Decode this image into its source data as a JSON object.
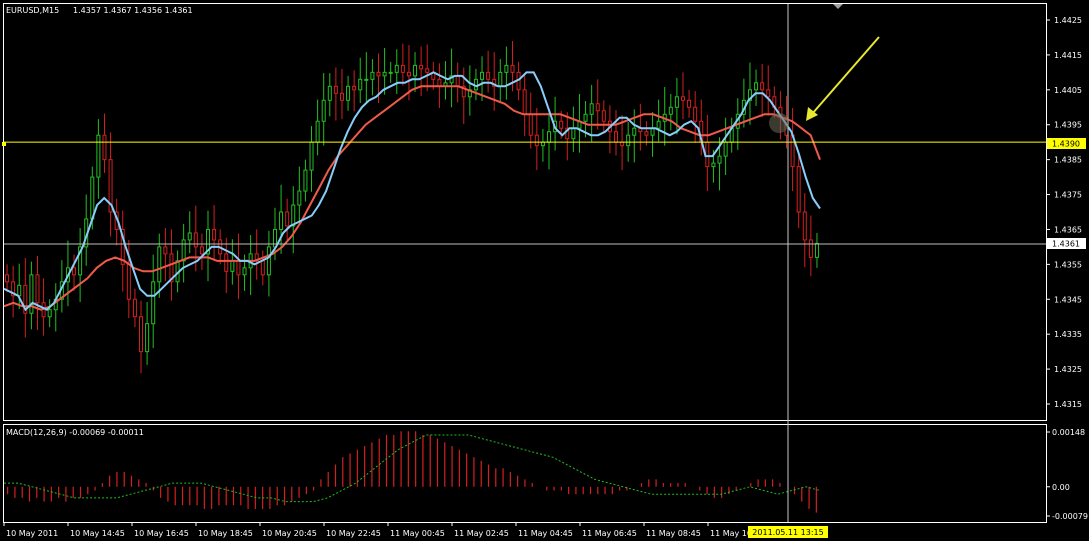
{
  "window": {
    "symbol_label": "EURUSD,M15",
    "ohlc_label": "1.4357 1.4367 1.4356 1.4361"
  },
  "colors": {
    "background": "#000000",
    "axis": "#ffffff",
    "bull": "#22c022",
    "bear": "#d42020",
    "ma_fast": "#87cefa",
    "ma_slow": "#f05a4a",
    "hline": "#ffff00",
    "signal": "#1fbf1f",
    "crosshair": "#c8c8c8",
    "arrow": "#e8e830"
  },
  "price_panel": {
    "ticks": [
      "1.4425",
      "1.4415",
      "1.4405",
      "1.4395",
      "1.4385",
      "1.4375",
      "1.4365",
      "1.4355",
      "1.4345",
      "1.4335",
      "1.4325",
      "1.4315"
    ],
    "hline_value": 1.439,
    "hline_label": "1.4390",
    "current_label": "1.4361",
    "current_value": 1.4361
  },
  "macd_panel": {
    "label": "MACD(12,26,9) -0.00069 -0.00011",
    "ticks": [
      "0.00148",
      "0.00",
      "-0.00079"
    ]
  },
  "time_axis": {
    "labels": [
      "10 May 2011",
      "10 May 14:45",
      "10 May 16:45",
      "10 May 18:45",
      "10 May 20:45",
      "10 May 22:45",
      "11 May 00:45",
      "11 May 02:45",
      "11 May 04:45",
      "11 May 06:45",
      "11 May 08:45",
      "11 May 10"
    ],
    "cursor_label": "2011.05.11 13:15"
  },
  "chart_data": {
    "type": "candlestick",
    "symbol": "EURUSD",
    "timeframe": "M15",
    "close": [
      1.435,
      1.4346,
      1.4349,
      1.4341,
      1.4352,
      1.4344,
      1.434,
      1.4342,
      1.4345,
      1.435,
      1.4354,
      1.4352,
      1.436,
      1.4368,
      1.438,
      1.4392,
      1.4385,
      1.437,
      1.4365,
      1.4355,
      1.4345,
      1.434,
      1.433,
      1.4338,
      1.435,
      1.436,
      1.4358,
      1.435,
      1.4356,
      1.4362,
      1.4364,
      1.436,
      1.4358,
      1.4365,
      1.4362,
      1.4358,
      1.4353,
      1.4356,
      1.4352,
      1.4354,
      1.4358,
      1.4356,
      1.4352,
      1.436,
      1.4365,
      1.437,
      1.4366,
      1.4372,
      1.4376,
      1.4382,
      1.439,
      1.4396,
      1.4402,
      1.4406,
      1.4404,
      1.4402,
      1.4406,
      1.4405,
      1.4408,
      1.4408,
      1.441,
      1.4409,
      1.441,
      1.441,
      1.4412,
      1.441,
      1.4409,
      1.4412,
      1.4411,
      1.441,
      1.4408,
      1.4406,
      1.4407,
      1.4409,
      1.4406,
      1.4403,
      1.4405,
      1.4408,
      1.441,
      1.4408,
      1.4406,
      1.441,
      1.4412,
      1.441,
      1.4405,
      1.4398,
      1.4392,
      1.4389,
      1.439,
      1.4393,
      1.4396,
      1.4394,
      1.4391,
      1.4394,
      1.4396,
      1.4398,
      1.4401,
      1.4399,
      1.4396,
      1.4393,
      1.439,
      1.4389,
      1.4392,
      1.4394,
      1.4393,
      1.4392,
      1.4394,
      1.4396,
      1.4398,
      1.44,
      1.4403,
      1.4402,
      1.44,
      1.4396,
      1.439,
      1.4383,
      1.4384,
      1.4386,
      1.439,
      1.4394,
      1.4398,
      1.4402,
      1.4405,
      1.4407,
      1.4405,
      1.4403,
      1.44,
      1.4397,
      1.4392,
      1.4383,
      1.437,
      1.4362,
      1.4357,
      1.4361
    ],
    "ma_fast": [
      1.4348,
      1.4347,
      1.4346,
      1.4342,
      1.4344,
      1.4343,
      1.4342,
      1.4344,
      1.4348,
      1.4352,
      1.4356,
      1.436,
      1.4366,
      1.4372,
      1.4374,
      1.4372,
      1.4367,
      1.436,
      1.4354,
      1.4348,
      1.4346,
      1.4346,
      1.4348,
      1.435,
      1.4352,
      1.4354,
      1.4355,
      1.4356,
      1.4358,
      1.436,
      1.436,
      1.4359,
      1.4358,
      1.4356,
      1.4356,
      1.4355,
      1.4356,
      1.4357,
      1.436,
      1.4364,
      1.4366,
      1.4367,
      1.4368,
      1.4369,
      1.4372,
      1.4376,
      1.4382,
      1.4388,
      1.4393,
      1.4397,
      1.44,
      1.4402,
      1.4403,
      1.4405,
      1.4406,
      1.4407,
      1.4407,
      1.4408,
      1.4408,
      1.4409,
      1.441,
      1.4409,
      1.4408,
      1.4409,
      1.4409,
      1.4407,
      1.4406,
      1.4407,
      1.4407,
      1.4406,
      1.4406,
      1.4407,
      1.4408,
      1.441,
      1.441,
      1.4406,
      1.44,
      1.4394,
      1.4392,
      1.4394,
      1.4394,
      1.4393,
      1.4392,
      1.4392,
      1.4393,
      1.4395,
      1.4397,
      1.4397,
      1.4395,
      1.4394,
      1.4394,
      1.4394,
      1.4393,
      1.4392,
      1.4393,
      1.4395,
      1.4396,
      1.4394,
      1.4386,
      1.4386,
      1.4389,
      1.4392,
      1.4395,
      1.4398,
      1.4402,
      1.4404,
      1.4404,
      1.4402,
      1.4399,
      1.4396,
      1.4393,
      1.4387,
      1.438,
      1.4374,
      1.4371
    ],
    "ma_slow": [
      1.4343,
      1.4344,
      1.4343,
      1.4343,
      1.4342,
      1.4343,
      1.4345,
      1.4347,
      1.4349,
      1.4351,
      1.4354,
      1.4356,
      1.4357,
      1.4356,
      1.4354,
      1.4353,
      1.4353,
      1.4354,
      1.4355,
      1.4356,
      1.4357,
      1.4357,
      1.4357,
      1.4356,
      1.4356,
      1.4356,
      1.4356,
      1.4356,
      1.4357,
      1.4358,
      1.436,
      1.4363,
      1.4367,
      1.4372,
      1.4377,
      1.4382,
      1.4386,
      1.4389,
      1.4392,
      1.4395,
      1.4397,
      1.4399,
      1.4401,
      1.4403,
      1.4405,
      1.4406,
      1.4406,
      1.4406,
      1.4406,
      1.4406,
      1.4405,
      1.4404,
      1.4403,
      1.4402,
      1.4401,
      1.4399,
      1.4398,
      1.4398,
      1.4398,
      1.4398,
      1.4398,
      1.4397,
      1.4396,
      1.4395,
      1.4395,
      1.4395,
      1.4395,
      1.4396,
      1.4397,
      1.4398,
      1.4398,
      1.4397,
      1.4396,
      1.4394,
      1.4393,
      1.4392,
      1.4392,
      1.4393,
      1.4394,
      1.4395,
      1.4396,
      1.4397,
      1.4398,
      1.4398,
      1.4397,
      1.4396,
      1.4394,
      1.4392,
      1.4385
    ],
    "macd_hist": [
      -0.0002,
      -0.0003,
      -0.0003,
      -0.0004,
      -0.0003,
      -0.0004,
      -0.0004,
      -0.0003,
      -0.0004,
      -0.0003,
      -0.0003,
      -0.0002,
      -0.0001,
      0.0001,
      0.0003,
      0.0004,
      0.0004,
      0.0003,
      0.0002,
      0.0001,
      -0.0001,
      -0.0003,
      -0.0004,
      -0.0005,
      -0.0005,
      -0.0005,
      -0.0005,
      -0.0006,
      -0.0006,
      -0.0005,
      -0.0005,
      -0.0005,
      -0.0005,
      -0.0006,
      -0.0006,
      -0.0006,
      -0.0006,
      -0.0005,
      -0.0005,
      -0.0004,
      -0.0003,
      -0.0002,
      -0.0001,
      0.0002,
      0.0004,
      0.0006,
      0.0008,
      0.0009,
      0.001,
      0.0011,
      0.0012,
      0.0013,
      0.0014,
      0.0014,
      0.0015,
      0.0015,
      0.0015,
      0.0014,
      0.0014,
      0.0013,
      0.0012,
      0.0011,
      0.001,
      0.0009,
      0.0008,
      0.0007,
      0.0006,
      0.0005,
      0.0005,
      0.0004,
      0.0003,
      0.0002,
      0.0001,
      0.0,
      -0.0001,
      -0.0001,
      -0.0001,
      -0.0002,
      -0.0002,
      -0.0002,
      -0.0002,
      -0.0002,
      -0.0002,
      -0.0002,
      -0.0001,
      -0.0001,
      0.0,
      0.0001,
      0.0002,
      0.0002,
      0.0001,
      0.0001,
      0.0001,
      0.0001,
      0.0,
      -0.0001,
      -0.0002,
      -0.0003,
      -0.0003,
      -0.0002,
      -0.0001,
      0.0,
      0.0001,
      0.0002,
      0.0002,
      0.0002,
      0.0001,
      0.0,
      -0.0002,
      -0.0004,
      -0.0006,
      -0.0007
    ],
    "macd_signal": [
      0.0001,
      0.0001,
      0.0,
      -0.0001,
      -0.0002,
      -0.0003,
      -0.0003,
      -0.0003,
      -0.0003,
      -0.0002,
      -0.0001,
      0.0,
      0.0001,
      0.0001,
      0.0001,
      0.0,
      -0.0001,
      -0.0002,
      -0.0003,
      -0.0003,
      -0.0004,
      -0.0004,
      -0.0004,
      -0.0003,
      -0.0001,
      0.0001,
      0.0004,
      0.0007,
      0.001,
      0.0012,
      0.0014,
      0.0014,
      0.0014,
      0.0014,
      0.0013,
      0.0012,
      0.0011,
      0.001,
      0.0009,
      0.0008,
      0.0006,
      0.0004,
      0.0002,
      0.0001,
      0.0,
      -0.0001,
      -0.0002,
      -0.0002,
      -0.0002,
      -0.0002,
      -0.0002,
      -0.0002,
      -0.0001,
      0.0,
      -0.0001,
      -0.0002,
      -0.0001,
      0.0,
      -0.0001
    ],
    "ylim_price": [
      1.431,
      1.443
    ],
    "ylim_macd": [
      -0.00079,
      0.00148
    ]
  }
}
